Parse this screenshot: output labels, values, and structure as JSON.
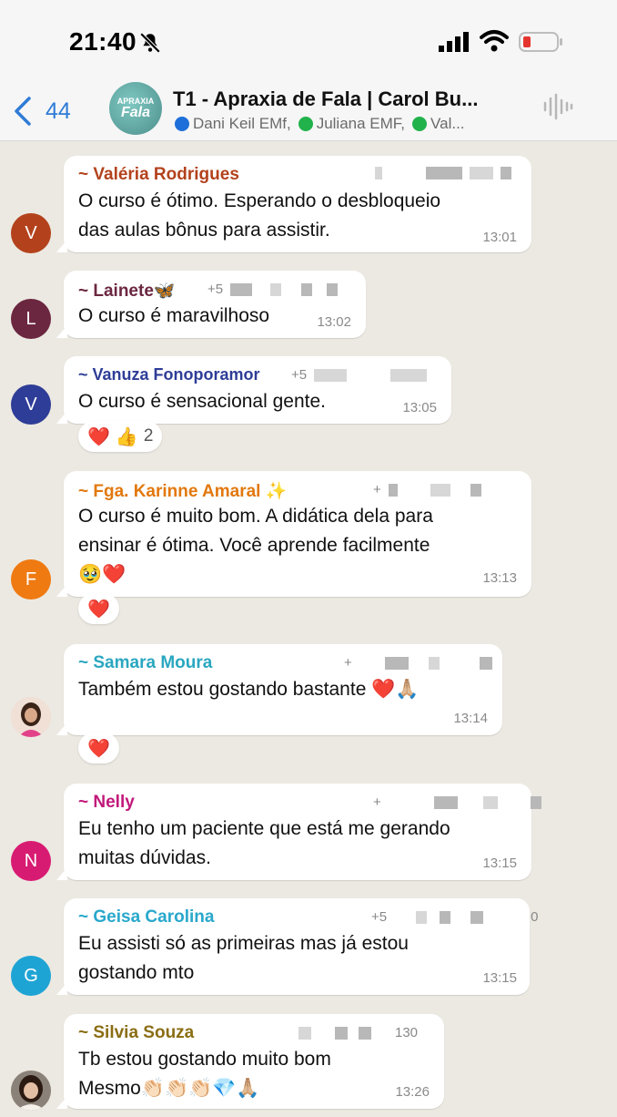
{
  "status_bar": {
    "time": "21:40"
  },
  "header": {
    "back_count": "44",
    "group_avatar": {
      "line1": "APRAXIA",
      "line2": "Fala"
    },
    "title": "T1 - Apraxia de Fala | Carol Bu...",
    "members": [
      "Dani Keil EMf,",
      "Juliana EMF,",
      "Val..."
    ]
  },
  "messages": [
    {
      "sender": "~ Valéria Rodrigues",
      "sender_color": "#b3421c",
      "avatar": "V",
      "avatar_color": "#b3421c",
      "lines": [
        "O curso é ótimo. Esperando o desbloqueio",
        "das aulas bônus para assistir."
      ],
      "time": "13:01"
    },
    {
      "sender": "~ Lainete🦋",
      "sender_color": "#6b2740",
      "avatar": "L",
      "avatar_color": "#6b2740",
      "phone_prefix": "+5",
      "lines": [
        "O curso é maravilhoso"
      ],
      "time": "13:02"
    },
    {
      "sender": "~ Vanuza Fonoporamor",
      "sender_color": "#2e3d97",
      "avatar": "V",
      "avatar_color": "#2e3d97",
      "phone_prefix": "+5",
      "lines": [
        "O curso é sensacional gente."
      ],
      "time": "13:05",
      "reactions": {
        "items": [
          "❤️",
          "👍"
        ],
        "count": "2"
      }
    },
    {
      "sender": "~ Fga. Karinne Amaral ✨",
      "sender_color": "#e2780d",
      "avatar": "F",
      "avatar_color": "#ef7a12",
      "phone_prefix": "+",
      "lines": [
        "O curso é muito bom. A didática dela para",
        "ensinar é ótima. Você aprende facilmente",
        "🥹❤️"
      ],
      "time": "13:13",
      "reactions": {
        "items": [
          "❤️"
        ]
      }
    },
    {
      "sender": "~ Samara Moura",
      "sender_color": "#2aa7c0",
      "phone_prefix": "+",
      "lines": [
        "Também estou gostando bastante ❤️🙏🏼"
      ],
      "time": "13:14",
      "reactions": {
        "items": [
          "❤️"
        ]
      }
    },
    {
      "sender": "~ Nelly",
      "sender_color": "#c2187a",
      "avatar": "N",
      "avatar_color": "#d81b72",
      "phone_prefix": "+",
      "lines": [
        "Eu tenho um paciente que está me gerando",
        "muitas dúvidas."
      ],
      "time": "13:15"
    },
    {
      "sender": "~ Geisa Carolina",
      "sender_color": "#29a8cc",
      "avatar": "G",
      "avatar_color": "#1ea4d4",
      "phone_prefix": "+5",
      "phone_suffix": "0",
      "lines": [
        "Eu assisti só as primeiras mas já estou",
        "gostando mto"
      ],
      "time": "13:15"
    },
    {
      "sender": "~ Silvia Souza",
      "sender_color": "#8a6d12",
      "phone_suffix": "130",
      "lines": [
        "Tb estou gostando muito bom",
        "Mesmo👏🏻👏🏻👏🏻💎🙏🏼"
      ],
      "time": "13:26"
    }
  ]
}
